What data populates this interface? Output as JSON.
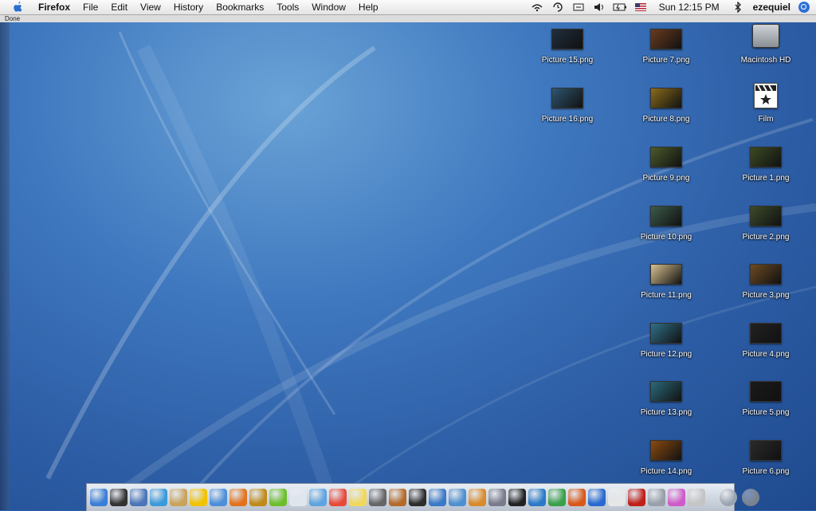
{
  "menubar": {
    "apple_icon": "apple-icon",
    "app_name": "Firefox",
    "menus": [
      "File",
      "Edit",
      "View",
      "History",
      "Bookmarks",
      "Tools",
      "Window",
      "Help"
    ],
    "status_icons": [
      "airport-icon",
      "timemachine-icon",
      "sync-icon",
      "volume-icon",
      "battery-icon",
      "flag-icon"
    ],
    "clock": "Sun 12:15 PM",
    "bluetooth_icon": "bluetooth-icon",
    "user": "ezequiel",
    "spotlight_icon": "spotlight-icon"
  },
  "status_strip": {
    "text": "Done"
  },
  "desktop_icons": [
    {
      "label": "Picture 15.png",
      "thumb": "#1f2e3e"
    },
    {
      "label": "Picture 7.png",
      "thumb": "#6b3a1f"
    },
    {
      "label": "Macintosh HD",
      "thumb": "#9aa0a6"
    },
    {
      "label": "Picture 16.png",
      "thumb": "#2e5570"
    },
    {
      "label": "Picture 8.png",
      "thumb": "#8a6b1a"
    },
    {
      "label": "Film",
      "thumb": "#ffffff"
    },
    {
      "label": "Picture 9.png",
      "thumb": "#4a5a2a"
    },
    {
      "label": "Picture 1.png",
      "thumb": "#3b4a22"
    },
    {
      "label": "Picture 10.png",
      "thumb": "#3a5a4a"
    },
    {
      "label": "Picture 2.png",
      "thumb": "#3c4a2a"
    },
    {
      "label": "Picture 11.png",
      "thumb": "#d8c090"
    },
    {
      "label": "Picture 3.png",
      "thumb": "#6b4a22"
    },
    {
      "label": "Picture 12.png",
      "thumb": "#2f7088"
    },
    {
      "label": "Picture 4.png",
      "thumb": "#222222"
    },
    {
      "label": "Picture 13.png",
      "thumb": "#2a6a7a"
    },
    {
      "label": "Picture 5.png",
      "thumb": "#1a1a1a"
    },
    {
      "label": "Picture 14.png",
      "thumb": "#8a4a10"
    },
    {
      "label": "Picture 6.png",
      "thumb": "#2a2a2a"
    }
  ],
  "dock": {
    "apps": [
      {
        "name": "finder-icon",
        "color": "#3b7ed6"
      },
      {
        "name": "dashboard-icon",
        "color": "#333333"
      },
      {
        "name": "preview-icon",
        "color": "#4a76b8"
      },
      {
        "name": "ichat-icon",
        "color": "#3a9ad9"
      },
      {
        "name": "address-book-icon",
        "color": "#c8a35a"
      },
      {
        "name": "smiley-icon",
        "color": "#f2c200"
      },
      {
        "name": "safari-icon",
        "color": "#4c8fd8"
      },
      {
        "name": "firefox-icon",
        "color": "#e2731e"
      },
      {
        "name": "warcraft-icon",
        "color": "#c08a1a"
      },
      {
        "name": "app-green-icon",
        "color": "#6cbf2a"
      },
      {
        "name": "mail-icon",
        "color": "#dfe6ee"
      },
      {
        "name": "itunes-icon",
        "color": "#5fa3e0"
      },
      {
        "name": "ical-icon",
        "color": "#e84a3a"
      },
      {
        "name": "stickies-icon",
        "color": "#f0d85a"
      },
      {
        "name": "magnifier-icon",
        "color": "#666666"
      },
      {
        "name": "photo-icon",
        "color": "#b36a2a"
      },
      {
        "name": "imovie-icon",
        "color": "#2d2d2d"
      },
      {
        "name": "clapper-icon",
        "color": "#3a79c8"
      },
      {
        "name": "iphoto-icon",
        "color": "#4e8fd0"
      },
      {
        "name": "paint-icon",
        "color": "#d98a2a"
      },
      {
        "name": "brush-icon",
        "color": "#7a7a8a"
      },
      {
        "name": "terminal-icon",
        "color": "#222222"
      },
      {
        "name": "utility-icon",
        "color": "#2a7ac8"
      },
      {
        "name": "plant-icon",
        "color": "#3aa04a"
      },
      {
        "name": "flash-icon",
        "color": "#d8581a"
      },
      {
        "name": "camino-icon",
        "color": "#2a6ad0"
      },
      {
        "name": "textedit-icon",
        "color": "#e7e7e7"
      },
      {
        "name": "red-app-icon",
        "color": "#c0201a"
      },
      {
        "name": "gear-app-icon",
        "color": "#9aa0aa"
      },
      {
        "name": "cube-icon",
        "color": "#d05ac8"
      },
      {
        "name": "apple-app-icon",
        "color": "#c4c4c4"
      }
    ],
    "docs": [
      {
        "name": "downloads-stack-icon",
        "color": "#9aa3b0"
      },
      {
        "name": "trash-icon",
        "color": "#7a828c"
      }
    ]
  }
}
